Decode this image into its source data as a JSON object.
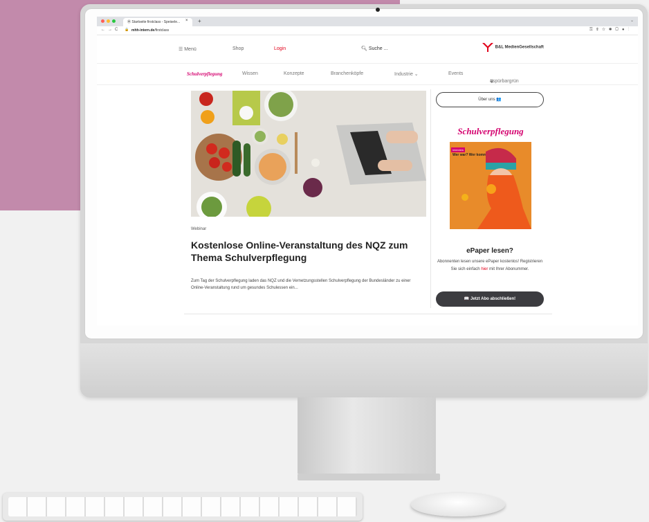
{
  "browser": {
    "tab_title": "Startseite firstclass - Speisele...",
    "tab_close": "×",
    "tab_plus": "+",
    "url_host": "mhh-intern.de",
    "url_path": "/firstclass",
    "window_dots": [
      "#ff5f57",
      "#febc2e",
      "#28c840"
    ]
  },
  "header": {
    "menu": "☰ Menü",
    "shop": "Shop",
    "login": "Login",
    "search": "Suche ...",
    "brand_name": "B&L MedienGesellschaft"
  },
  "nav": {
    "brand": "Schulverpflegung",
    "items": [
      "Wissen",
      "Konzepte",
      "Branchenköpfe",
      "Industrie ⌄",
      "Events",
      "#spürbargrün"
    ]
  },
  "article": {
    "category": "Webinar",
    "title": "Kostenlose Online-Veranstaltung des NQZ zum Thema Schulverpflegung",
    "excerpt": "Zum Tag der Schulverpflegung laden das NQZ und die Vernetzungsstellen Schulverpflegung der Bundesländer zu einer Online-Veranstaltung rund um gesundes Schulessen ein..."
  },
  "aside": {
    "about_button": "Über uns 👥",
    "cover_title": "Schulverpflegung",
    "cover_tag": "Interview",
    "cover_subtitle": "Wer war? Wer kommt?",
    "epaper_title": "ePaper lesen?",
    "epaper_text_1": "Abonnenten lesen unsere ePaper kostenlos! Registrieren Sie sich einfach",
    "epaper_link": "hier",
    "epaper_text_2": "mit Ihrer Abonummer.",
    "abo_button": "📖 Jetzt Abo abschließen!"
  },
  "colors": {
    "accent": "#d4006e",
    "login_red": "#e2001a",
    "button_dark": "#3c3c40",
    "backdrop_pink": "#c28aab"
  }
}
